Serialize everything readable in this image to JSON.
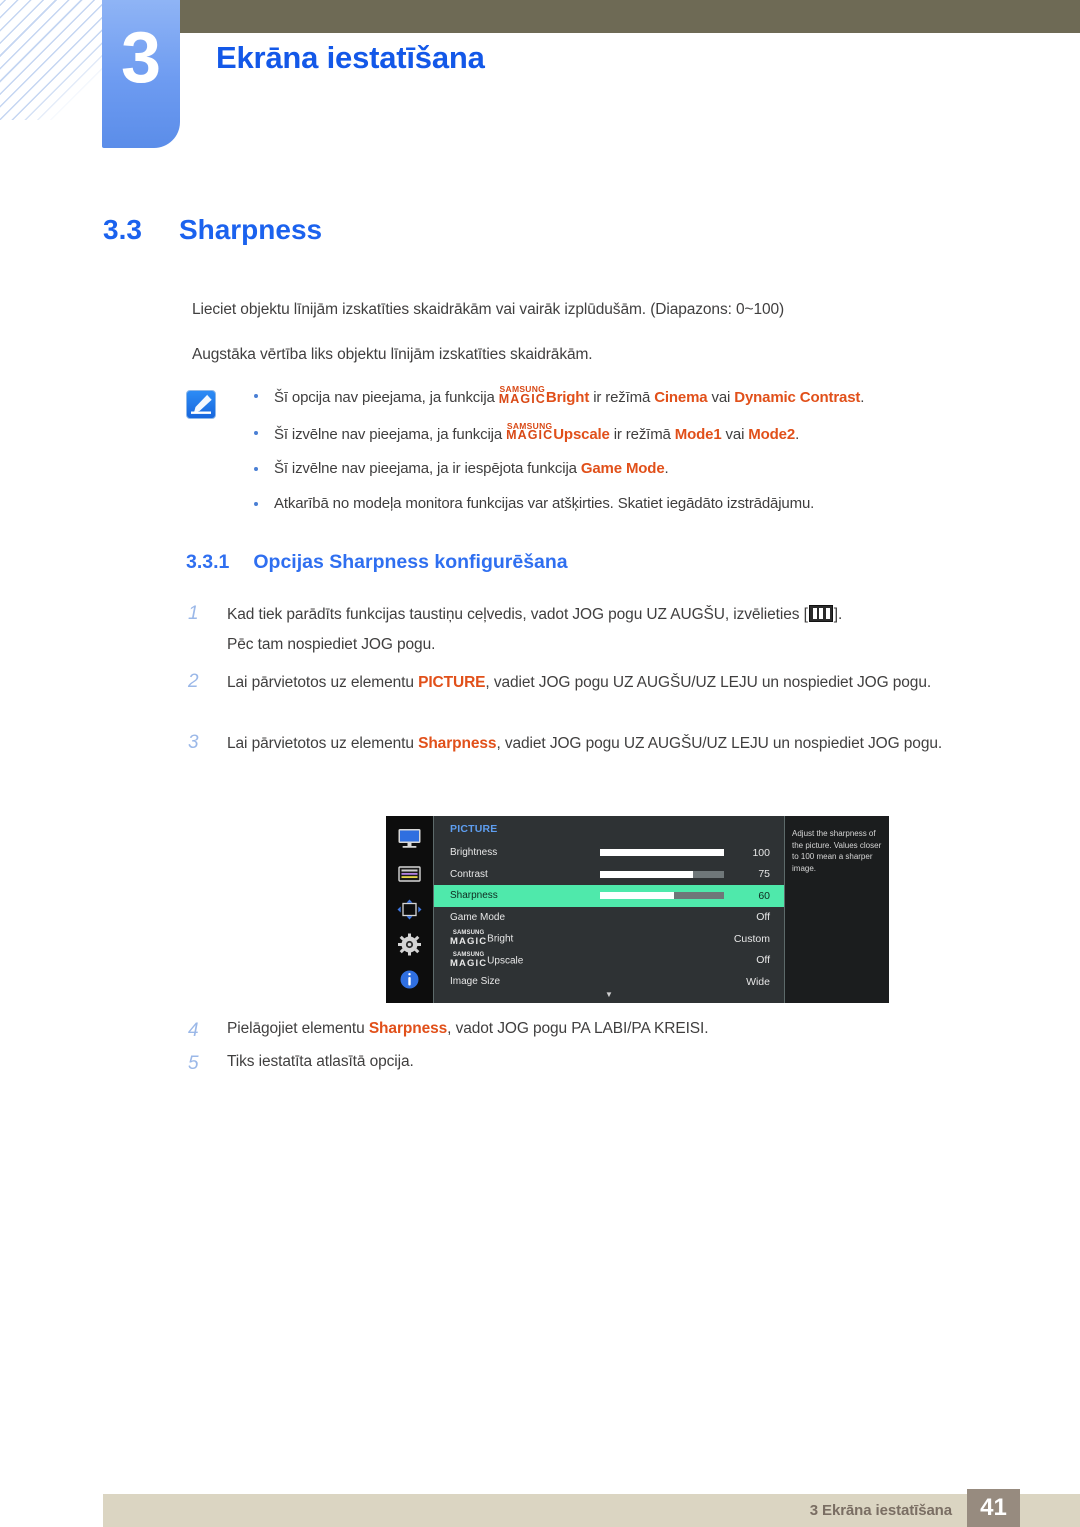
{
  "header": {
    "chapter_number": "3",
    "chapter_title": "Ekrāna iestatīšana"
  },
  "section": {
    "number": "3.3",
    "title": "Sharpness"
  },
  "intro": {
    "paragraph_1": "Lieciet objektu līnijām izskatīties skaidrākām vai vairāk izplūdušām. (Diapazons: 0~100)",
    "paragraph_2": "Augstāka vērtība liks objektu līnijām izskatīties skaidrākām."
  },
  "note": {
    "icon": "note-pen-icon",
    "bullets": [
      {
        "pre": "Šī opcija nav pieejama, ja funkcija ",
        "magic_top": "SAMSUNG",
        "magic_bottom": "MAGIC",
        "magic_suffix": "Bright",
        "mid": " ir režīmā ",
        "hl1": "Cinema",
        "mid2": " vai ",
        "hl2": "Dynamic Contrast",
        "post": "."
      },
      {
        "pre": "Šī izvēlne nav pieejama, ja funkcija ",
        "magic_top": "SAMSUNG",
        "magic_bottom": "MAGIC",
        "magic_suffix": "Upscale",
        "mid": " ir režīmā ",
        "hl1": "Mode1",
        "mid2": " vai ",
        "hl2": "Mode2",
        "post": "."
      },
      {
        "pre": "Šī izvēlne nav pieejama, ja ir iespējota funkcija ",
        "hl1": "Game Mode",
        "post": "."
      },
      {
        "pre": "Atkarībā no modeļa monitora funkcijas var atšķirties. Skatiet iegādāto izstrādājumu."
      }
    ]
  },
  "subsection": {
    "number": "3.3.1",
    "title": "Opcijas Sharpness konfigurēšana"
  },
  "steps": [
    {
      "num": "1",
      "line1_pre": "Kad tiek parādīts funkcijas taustiņu ceļvedis, vadot JOG pogu UZ AUGŠU, izvēlieties [",
      "icon": "picture-menu-icon",
      "line1_post": "].",
      "line2": "Pēc tam nospiediet JOG pogu."
    },
    {
      "num": "2",
      "pre": "Lai pārvietotos uz elementu ",
      "hl": "PICTURE",
      "post": ", vadiet JOG pogu UZ AUGŠU/UZ LEJU un nospiediet JOG pogu."
    },
    {
      "num": "3",
      "pre": "Lai pārvietotos uz elementu ",
      "hl": "Sharpness",
      "post": ", vadiet JOG pogu UZ AUGŠU/UZ LEJU un nospiediet JOG pogu."
    },
    {
      "num": "4",
      "pre": "Pielāgojiet elementu ",
      "hl": "Sharpness",
      "post": ", vadot JOG pogu PA LABI/PA KREISI."
    },
    {
      "num": "5",
      "pre": "Tiks iestatīta atlasītā opcija."
    }
  ],
  "osd": {
    "sidebar_icons": [
      "monitor-picture-icon",
      "onscreen-display-icon",
      "system-position-icon",
      "setup-gear-icon",
      "information-icon"
    ],
    "menu_title": "PICTURE",
    "rows": [
      {
        "label": "Brightness",
        "value": "100",
        "bar": 100,
        "selected": false,
        "has_bar": true
      },
      {
        "label": "Contrast",
        "value": "75",
        "bar": 75,
        "selected": false,
        "has_bar": true
      },
      {
        "label": "Sharpness",
        "value": "60",
        "bar": 60,
        "selected": true,
        "has_bar": true
      },
      {
        "label": "Game Mode",
        "value": "Off",
        "selected": false,
        "has_bar": false
      },
      {
        "label": "Bright",
        "magic_top": "SAMSUNG",
        "magic_bottom": "MAGIC",
        "value": "Custom",
        "selected": false,
        "has_bar": false
      },
      {
        "label": "Upscale",
        "magic_top": "SAMSUNG",
        "magic_bottom": "MAGIC",
        "value": "Off",
        "selected": false,
        "has_bar": false
      },
      {
        "label": "Image Size",
        "value": "Wide",
        "selected": false,
        "has_bar": false
      }
    ],
    "scroll_arrow": "▼",
    "help_text": "Adjust the sharpness of the picture. Values closer to 100 mean a sharper image."
  },
  "footer": {
    "text": "3 Ekrāna iestatīšana",
    "page": "41"
  },
  "colors": {
    "accent_blue": "#1b62ee",
    "highlight_orange": "#e1501a",
    "osd_selected_green": "#4fe9ab",
    "footer_bar": "#dbd5c2",
    "header_olive": "#6e6a55"
  }
}
